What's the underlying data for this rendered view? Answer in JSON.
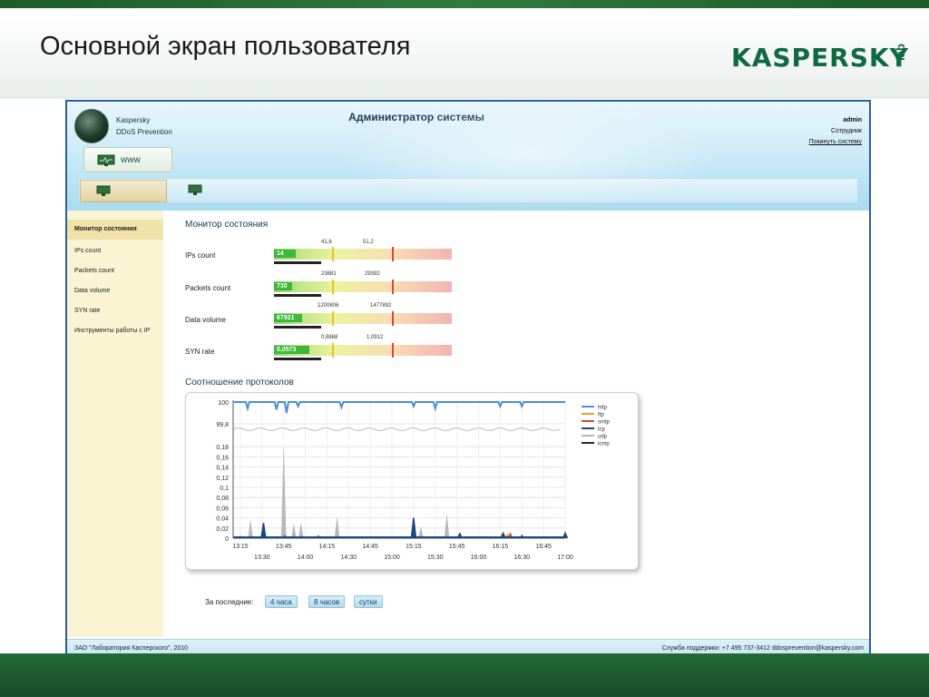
{
  "slide": {
    "title": "Основной экран пользователя",
    "logo_text": "KASPERSKY",
    "logo_sub": "lab"
  },
  "app": {
    "brand_line1": "Kaspersky",
    "brand_line2": "DDoS Prevention",
    "title": "Администратор системы",
    "user": {
      "name": "admin",
      "role": "Сотрудник",
      "logout": "Покинуть систему"
    },
    "site_tab": "www",
    "sidebar": [
      {
        "label": "Монитор состояния",
        "active": true
      },
      {
        "label": "IPs count"
      },
      {
        "label": "Packets count"
      },
      {
        "label": "Data volume"
      },
      {
        "label": "SYN rate"
      },
      {
        "label": "Инструменты работы с IP"
      }
    ],
    "monitor_title": "Монитор состояния",
    "gauges": [
      {
        "label": "IPs count",
        "value": "14",
        "warn": "41,6",
        "crit": "51,2",
        "level": 0.12
      },
      {
        "label": "Packets count",
        "value": "730",
        "warn": "23881",
        "crit": "29392",
        "level": 0.1
      },
      {
        "label": "Data volume",
        "value": "67921",
        "warn": "1200806",
        "crit": "1477892",
        "level": 0.16
      },
      {
        "label": "SYN rate",
        "value": "0,0573",
        "warn": "0,8868",
        "crit": "1,0912",
        "level": 0.2
      }
    ],
    "protocols_title": "Соотношение протоколов",
    "period_label": "За последние:",
    "periods": [
      "4 часа",
      "8 часов",
      "сутки"
    ],
    "footer_left": "ЗАО \"Лаборатория Касперского\", 2010",
    "footer_right": "Служба поддержки:   +7 495 737-3412   ddosprevention@kaspersky.com"
  },
  "colors": {
    "green_dark": "#1d5a2c",
    "header_blue": "#a9dcef",
    "sidebar_bg": "#fbf4d3",
    "warn_marker": "#e6c619",
    "crit_marker": "#d64a3a",
    "http": "#4a90d9",
    "ftp": "#f0a030",
    "smtp": "#d84a3a",
    "tcp": "#1a4a7a",
    "udp": "#b8b8b8",
    "icmp": "#1a2a4a"
  },
  "chart_data": {
    "type": "line",
    "title": "",
    "top_axis_ticks": [
      "100",
      "99,8"
    ],
    "y_ticks": [
      "0,18",
      "0,16",
      "0,14",
      "0,12",
      "0,1",
      "0,08",
      "0,06",
      "0,04",
      "0,02",
      "0"
    ],
    "x_ticks_upper": [
      "13:15",
      "13:45",
      "14:15",
      "14:45",
      "15:15",
      "15:45",
      "16:15",
      "16:45"
    ],
    "x_ticks_lower": [
      "13:30",
      "14:00",
      "14:30",
      "15:00",
      "15:30",
      "16:00",
      "16:30",
      "17:00"
    ],
    "ylim": [
      0,
      0.2
    ],
    "series": [
      {
        "name": "http",
        "values": []
      },
      {
        "name": "ftp",
        "values": []
      },
      {
        "name": "smtp",
        "values": []
      },
      {
        "name": "tcp",
        "values": []
      },
      {
        "name": "udp",
        "values": []
      },
      {
        "name": "icmp",
        "values": []
      }
    ],
    "http_dips": [
      {
        "t": "13:20",
        "v": 99.94
      },
      {
        "t": "13:40",
        "v": 99.93
      },
      {
        "t": "13:47",
        "v": 99.9
      },
      {
        "t": "13:55",
        "v": 99.96
      },
      {
        "t": "14:25",
        "v": 99.95
      },
      {
        "t": "15:15",
        "v": 99.96
      },
      {
        "t": "15:30",
        "v": 99.94
      },
      {
        "t": "16:15",
        "v": 99.96
      },
      {
        "t": "16:30",
        "v": 99.96
      }
    ],
    "udp_spikes": [
      {
        "t": "13:22",
        "v": 0.034
      },
      {
        "t": "13:45",
        "v": 0.176
      },
      {
        "t": "13:52",
        "v": 0.027
      },
      {
        "t": "13:57",
        "v": 0.029
      },
      {
        "t": "14:22",
        "v": 0.04
      },
      {
        "t": "15:20",
        "v": 0.022
      },
      {
        "t": "15:38",
        "v": 0.045
      }
    ],
    "tcp_spikes": [
      {
        "t": "13:15",
        "v": 0.003
      },
      {
        "t": "13:31",
        "v": 0.03
      },
      {
        "t": "13:46",
        "v": 0.004
      },
      {
        "t": "14:09",
        "v": 0.004
      },
      {
        "t": "15:15",
        "v": 0.04
      },
      {
        "t": "15:47",
        "v": 0.009
      },
      {
        "t": "16:17",
        "v": 0.01
      },
      {
        "t": "16:30",
        "v": 0.005
      },
      {
        "t": "17:00",
        "v": 0.01
      }
    ],
    "ftp_spikes": [
      {
        "t": "16:20",
        "v": 0.008
      },
      {
        "t": "16:31",
        "v": 0.004
      }
    ],
    "smtp_spikes": [
      {
        "t": "16:22",
        "v": 0.01
      }
    ],
    "legend": [
      "http",
      "ftp",
      "smtp",
      "tcp",
      "udp",
      "icmp"
    ],
    "legend_position": "right"
  }
}
